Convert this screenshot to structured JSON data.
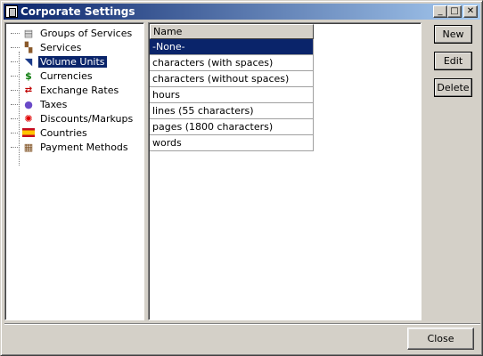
{
  "window": {
    "title": "Corporate Settings",
    "controls": {
      "minimize": "_",
      "maximize": "□",
      "close": "✕"
    }
  },
  "tree": {
    "items": [
      {
        "label": "Groups of Services",
        "icon": "groups-icon"
      },
      {
        "label": "Services",
        "icon": "services-icon"
      },
      {
        "label": "Volume Units",
        "icon": "volume-units-icon",
        "selected": true
      },
      {
        "label": "Currencies",
        "icon": "dollar-icon"
      },
      {
        "label": "Exchange Rates",
        "icon": "exchange-arrows-icon"
      },
      {
        "label": "Taxes",
        "icon": "taxes-icon"
      },
      {
        "label": "Discounts/Markups",
        "icon": "discount-icon"
      },
      {
        "label": "Countries",
        "icon": "flag-icon"
      },
      {
        "label": "Payment Methods",
        "icon": "payment-icon"
      }
    ]
  },
  "grid": {
    "columns": [
      "Name"
    ],
    "rows": [
      "-None-",
      "characters (with spaces)",
      "characters (without spaces)",
      "hours",
      "lines (55 characters)",
      "pages (1800 characters)",
      "words"
    ],
    "selected_index": 0
  },
  "buttons": {
    "new": "New",
    "edit": "Edit",
    "delete": "Delete",
    "close": "Close"
  },
  "colors": {
    "selection": "#0a246a",
    "face": "#d4d0c8"
  }
}
